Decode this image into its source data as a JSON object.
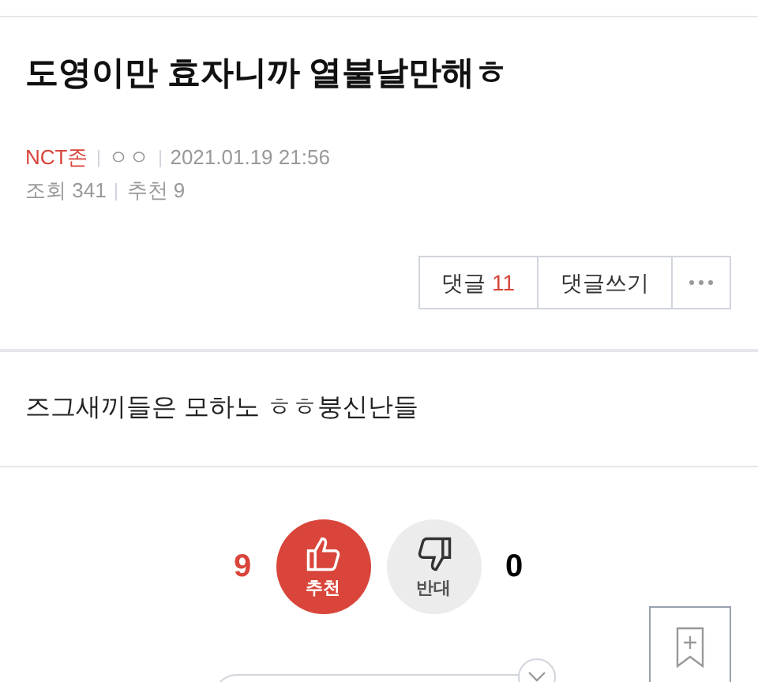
{
  "post": {
    "title": "도영이만 효자니까 열불날만해ㅎ",
    "board": "NCT존",
    "author": "ㅇㅇ",
    "datetime": "2021.01.19 21:56",
    "views": "조회 341",
    "recommends": "추천 9"
  },
  "actions": {
    "comment_label": "댓글",
    "comment_count": "11",
    "write_comment": "댓글쓰기"
  },
  "body": "즈그새끼들은 모하노 ㅎㅎ붕신난들",
  "votes": {
    "up_count": "9",
    "up_label": "추천",
    "down_label": "반대",
    "down_count": "0"
  }
}
